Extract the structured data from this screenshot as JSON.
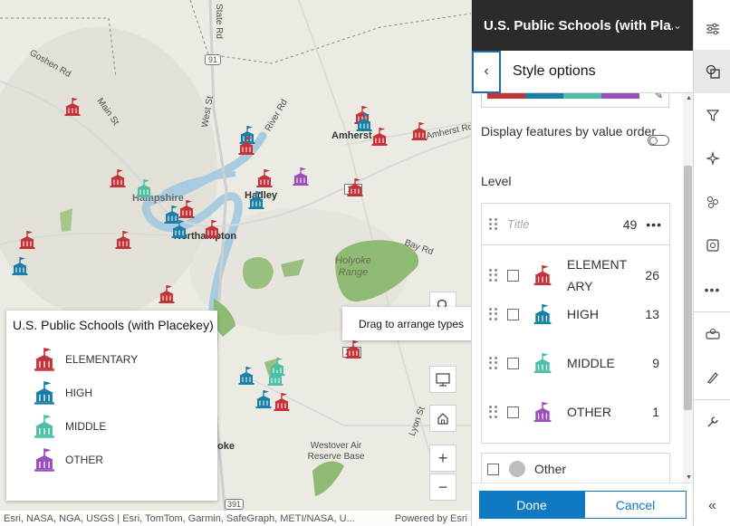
{
  "map": {
    "labels": {
      "goshen_rd": "Goshen Rd",
      "main_st": "Main St",
      "west_st": "West St",
      "river_rd": "River Rd",
      "state_rd": "State Rd",
      "amherst": "Amherst",
      "amherst_rd": "Amherst Rd",
      "hampshire": "Hampshire",
      "hadley": "Hadley",
      "northampton": "Northampton",
      "bay_rd": "Bay Rd",
      "holyoke_range": "Holyoke Range",
      "lyon_st": "Lyon St",
      "westover": "Westover Air Reserve Base",
      "ludlow_partial": "oke",
      "route_91": "91",
      "route_116": "116",
      "route_202": "202",
      "route_391": "391"
    },
    "attribution_left": "Esri, NASA, NGA, USGS | Esri, TomTom, Garmin, SafeGraph, METI/NASA, U...",
    "attribution_right": "Powered by Esri"
  },
  "legend": {
    "title": "U.S. Public Schools (with Placekey)",
    "items": [
      {
        "label": "ELEMENTARY",
        "color": "#c2333a"
      },
      {
        "label": "HIGH",
        "color": "#1a7fa6"
      },
      {
        "label": "MIDDLE",
        "color": "#4cbfa6"
      },
      {
        "label": "OTHER",
        "color": "#9b4fbd"
      }
    ]
  },
  "tooltip": "Drag to arrange types",
  "panel": {
    "layer_title": "U.S. Public Schools (with Pla...",
    "subtitle": "Style options",
    "display_order_label": "Display features by value order",
    "field_label": "Level",
    "title_placeholder": "Title",
    "total_count": "49",
    "types": [
      {
        "name": "ELEMENTARY",
        "name_display": "ELEMENT ARY",
        "count": "26",
        "color": "#c2333a"
      },
      {
        "name": "HIGH",
        "count": "13",
        "color": "#1a7fa6"
      },
      {
        "name": "MIDDLE",
        "count": "9",
        "color": "#4cbfa6"
      },
      {
        "name": "OTHER",
        "count": "1",
        "color": "#9b4fbd"
      }
    ],
    "other_label": "Other",
    "done": "Done",
    "cancel": "Cancel"
  },
  "ramp_colors": [
    "#c2333a",
    "#1a7fa6",
    "#4cbfa6",
    "#9b4fbd"
  ],
  "toolbar_icons": [
    "properties-icon",
    "styles-icon",
    "filter-icon",
    "effects-icon",
    "clustering-icon",
    "popups-icon",
    "more-icon",
    "pop-icon",
    "sketch-icon",
    "configure-icon",
    "collapse-icon"
  ]
}
